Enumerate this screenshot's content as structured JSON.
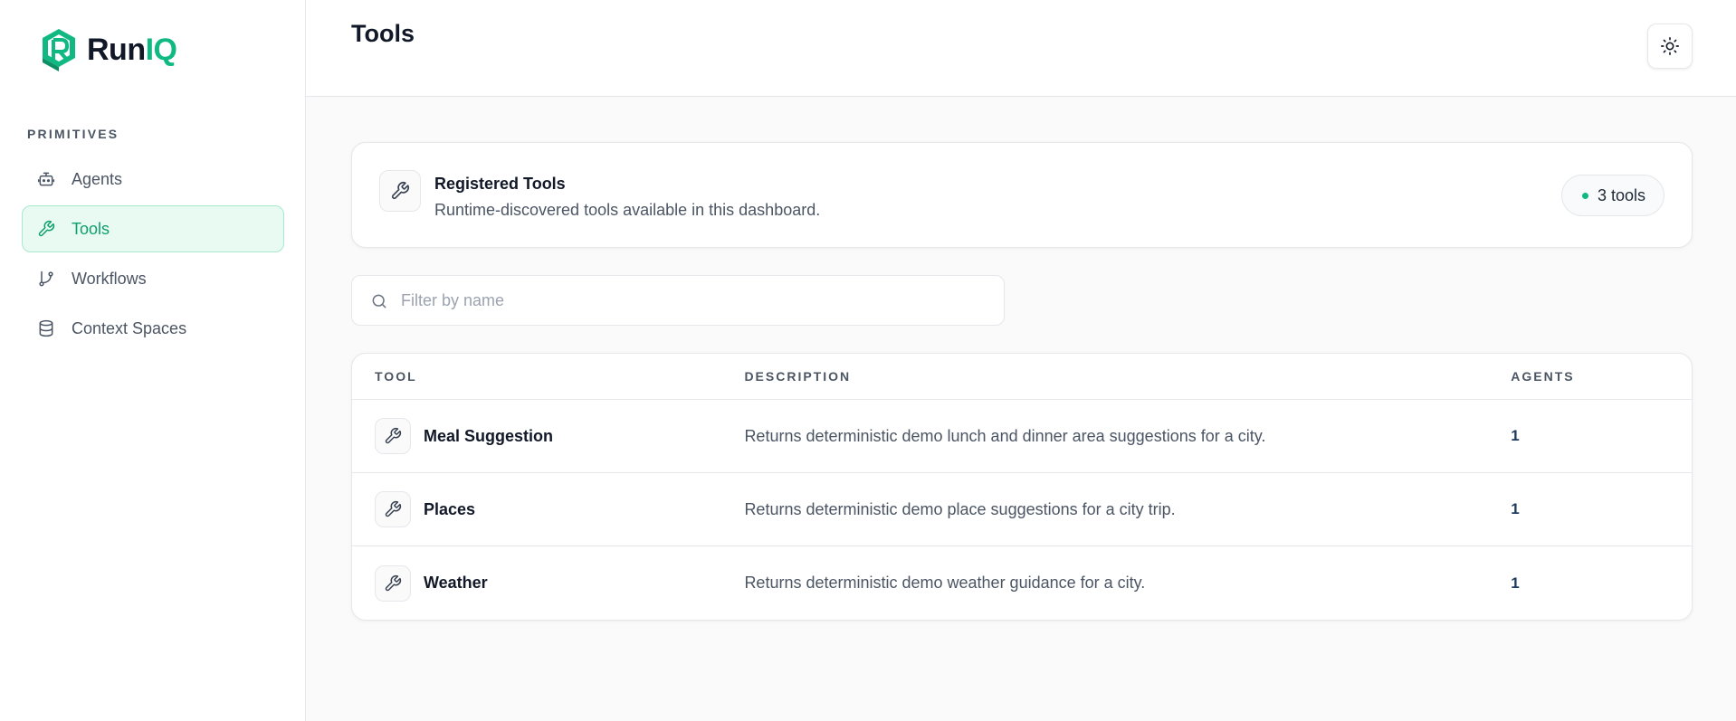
{
  "brand": {
    "name_part1": "Run",
    "name_part2": "IQ",
    "accent": "#10b981"
  },
  "sidebar": {
    "section_label": "PRIMITIVES",
    "items": [
      {
        "label": "Agents",
        "icon": "bot-icon",
        "active": false
      },
      {
        "label": "Tools",
        "icon": "wrench-icon",
        "active": true
      },
      {
        "label": "Workflows",
        "icon": "git-branch-icon",
        "active": false
      },
      {
        "label": "Context Spaces",
        "icon": "database-icon",
        "active": false
      }
    ]
  },
  "header": {
    "title": "Tools",
    "theme_toggle_icon": "sun-icon"
  },
  "summary": {
    "title": "Registered Tools",
    "subtitle": "Runtime-discovered tools available in this dashboard.",
    "count_label": "3 tools"
  },
  "search": {
    "placeholder": "Filter by name",
    "value": ""
  },
  "table": {
    "columns": [
      "TOOL",
      "DESCRIPTION",
      "AGENTS"
    ],
    "rows": [
      {
        "name": "Meal Suggestion",
        "description": "Returns deterministic demo lunch and dinner area suggestions for a city.",
        "agents": "1"
      },
      {
        "name": "Places",
        "description": "Returns deterministic demo place suggestions for a city trip.",
        "agents": "1"
      },
      {
        "name": "Weather",
        "description": "Returns deterministic demo weather guidance for a city.",
        "agents": "1"
      }
    ]
  }
}
